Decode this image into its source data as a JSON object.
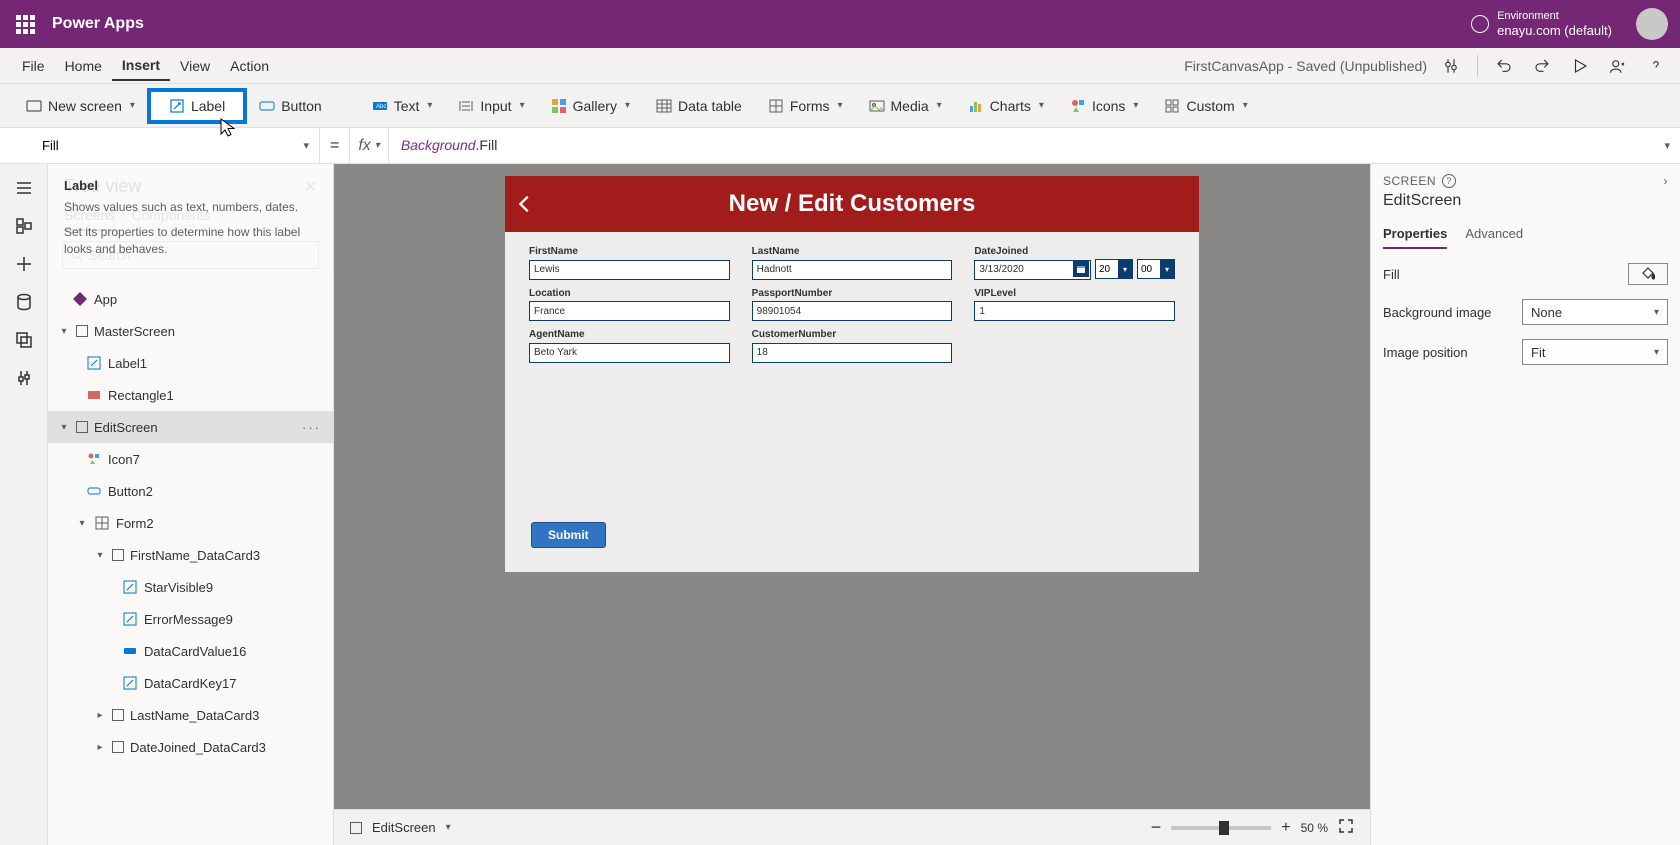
{
  "header": {
    "app_name": "Power Apps",
    "env_label": "Environment",
    "env_value": "enayu.com (default)"
  },
  "menu": {
    "items": [
      "File",
      "Home",
      "Insert",
      "View",
      "Action"
    ],
    "active_index": 2,
    "app_status": "FirstCanvasApp - Saved (Unpublished)"
  },
  "ribbon": {
    "new_screen": "New screen",
    "label": "Label",
    "button": "Button",
    "text": "Text",
    "input": "Input",
    "gallery": "Gallery",
    "data_table": "Data table",
    "forms": "Forms",
    "media": "Media",
    "charts": "Charts",
    "icons": "Icons",
    "custom": "Custom"
  },
  "formula": {
    "property": "Fill",
    "fx": "fx",
    "object": "Background",
    "dot_prop": ".Fill"
  },
  "tooltip": {
    "title": "Label",
    "line1": "Shows values such as text, numbers, dates.",
    "line2": "Set its properties to determine how this label looks and behaves."
  },
  "tree": {
    "title": "Tree view",
    "tabs": [
      "Screens",
      "Components"
    ],
    "search_placeholder": "Search",
    "items": {
      "app": "App",
      "master": "MasterScreen",
      "label1": "Label1",
      "rect1": "Rectangle1",
      "edit": "EditScreen",
      "icon7": "Icon7",
      "button2": "Button2",
      "form2": "Form2",
      "fn_card": "FirstName_DataCard3",
      "star": "StarVisible9",
      "err": "ErrorMessage9",
      "dcv": "DataCardValue16",
      "dck": "DataCardKey17",
      "ln_card": "LastName_DataCard3",
      "dj_card": "DateJoined_DataCard3"
    }
  },
  "canvas": {
    "header_title": "New / Edit Customers",
    "fields": {
      "firstname": {
        "label": "FirstName",
        "value": "Lewis"
      },
      "lastname": {
        "label": "LastName",
        "value": "Hadnott"
      },
      "datejoined": {
        "label": "DateJoined",
        "value": "3/13/2020",
        "hour": "20",
        "minute": "00"
      },
      "location": {
        "label": "Location",
        "value": "France"
      },
      "passport": {
        "label": "PassportNumber",
        "value": "98901054"
      },
      "vip": {
        "label": "VIPLevel",
        "value": "1"
      },
      "agent": {
        "label": "AgentName",
        "value": "Beto Yark"
      },
      "custnum": {
        "label": "CustomerNumber",
        "value": "18"
      }
    },
    "submit": "Submit"
  },
  "footer": {
    "breadcrumb": "EditScreen",
    "zoom": "50",
    "pct": "%"
  },
  "right": {
    "section": "SCREEN",
    "name": "EditScreen",
    "tabs": [
      "Properties",
      "Advanced"
    ],
    "rows": {
      "fill": "Fill",
      "bgimage": "Background image",
      "bgimage_val": "None",
      "imgpos": "Image position",
      "imgpos_val": "Fit"
    }
  }
}
